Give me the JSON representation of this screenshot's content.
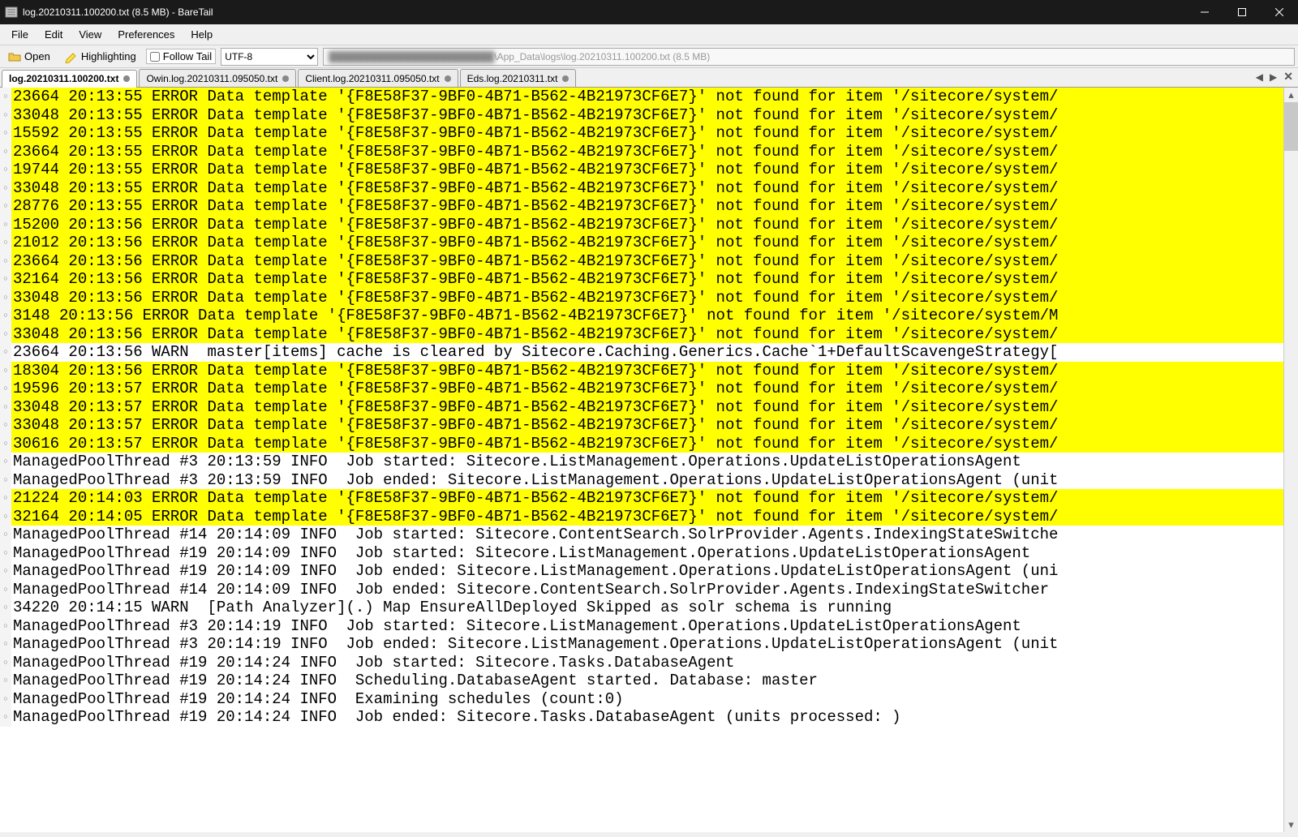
{
  "window": {
    "title": "log.20210311.100200.txt (8.5 MB) - BareTail"
  },
  "menu": {
    "file": "File",
    "edit": "Edit",
    "view": "View",
    "preferences": "Preferences",
    "help": "Help"
  },
  "toolbar": {
    "open": "Open",
    "highlighting": "Highlighting",
    "followtail": "Follow Tail",
    "encoding": "UTF-8",
    "path_suffix": "\\App_Data\\logs\\log.20210311.100200.txt (8.5 MB)"
  },
  "tabs": [
    {
      "label": "log.20210311.100200.txt",
      "active": true
    },
    {
      "label": "Owin.log.20210311.095050.txt",
      "active": false
    },
    {
      "label": "Client.log.20210311.095050.txt",
      "active": false
    },
    {
      "label": "Eds.log.20210311.txt",
      "active": false
    }
  ],
  "log": [
    {
      "hl": true,
      "text": "23664 20:13:55 ERROR Data template '{F8E58F37-9BF0-4B71-B562-4B21973CF6E7}' not found for item '/sitecore/system/"
    },
    {
      "hl": true,
      "text": "33048 20:13:55 ERROR Data template '{F8E58F37-9BF0-4B71-B562-4B21973CF6E7}' not found for item '/sitecore/system/"
    },
    {
      "hl": true,
      "text": "15592 20:13:55 ERROR Data template '{F8E58F37-9BF0-4B71-B562-4B21973CF6E7}' not found for item '/sitecore/system/"
    },
    {
      "hl": true,
      "text": "23664 20:13:55 ERROR Data template '{F8E58F37-9BF0-4B71-B562-4B21973CF6E7}' not found for item '/sitecore/system/"
    },
    {
      "hl": true,
      "text": "19744 20:13:55 ERROR Data template '{F8E58F37-9BF0-4B71-B562-4B21973CF6E7}' not found for item '/sitecore/system/"
    },
    {
      "hl": true,
      "text": "33048 20:13:55 ERROR Data template '{F8E58F37-9BF0-4B71-B562-4B21973CF6E7}' not found for item '/sitecore/system/"
    },
    {
      "hl": true,
      "text": "28776 20:13:55 ERROR Data template '{F8E58F37-9BF0-4B71-B562-4B21973CF6E7}' not found for item '/sitecore/system/"
    },
    {
      "hl": true,
      "text": "15200 20:13:56 ERROR Data template '{F8E58F37-9BF0-4B71-B562-4B21973CF6E7}' not found for item '/sitecore/system/"
    },
    {
      "hl": true,
      "text": "21012 20:13:56 ERROR Data template '{F8E58F37-9BF0-4B71-B562-4B21973CF6E7}' not found for item '/sitecore/system/"
    },
    {
      "hl": true,
      "text": "23664 20:13:56 ERROR Data template '{F8E58F37-9BF0-4B71-B562-4B21973CF6E7}' not found for item '/sitecore/system/"
    },
    {
      "hl": true,
      "text": "32164 20:13:56 ERROR Data template '{F8E58F37-9BF0-4B71-B562-4B21973CF6E7}' not found for item '/sitecore/system/"
    },
    {
      "hl": true,
      "text": "33048 20:13:56 ERROR Data template '{F8E58F37-9BF0-4B71-B562-4B21973CF6E7}' not found for item '/sitecore/system/"
    },
    {
      "hl": true,
      "text": "3148 20:13:56 ERROR Data template '{F8E58F37-9BF0-4B71-B562-4B21973CF6E7}' not found for item '/sitecore/system/M"
    },
    {
      "hl": true,
      "text": "33048 20:13:56 ERROR Data template '{F8E58F37-9BF0-4B71-B562-4B21973CF6E7}' not found for item '/sitecore/system/"
    },
    {
      "hl": false,
      "text": "23664 20:13:56 WARN  master[items] cache is cleared by Sitecore.Caching.Generics.Cache`1+DefaultScavengeStrategy["
    },
    {
      "hl": true,
      "text": "18304 20:13:56 ERROR Data template '{F8E58F37-9BF0-4B71-B562-4B21973CF6E7}' not found for item '/sitecore/system/"
    },
    {
      "hl": true,
      "text": "19596 20:13:57 ERROR Data template '{F8E58F37-9BF0-4B71-B562-4B21973CF6E7}' not found for item '/sitecore/system/"
    },
    {
      "hl": true,
      "text": "33048 20:13:57 ERROR Data template '{F8E58F37-9BF0-4B71-B562-4B21973CF6E7}' not found for item '/sitecore/system/"
    },
    {
      "hl": true,
      "text": "33048 20:13:57 ERROR Data template '{F8E58F37-9BF0-4B71-B562-4B21973CF6E7}' not found for item '/sitecore/system/"
    },
    {
      "hl": true,
      "text": "30616 20:13:57 ERROR Data template '{F8E58F37-9BF0-4B71-B562-4B21973CF6E7}' not found for item '/sitecore/system/"
    },
    {
      "hl": false,
      "text": "ManagedPoolThread #3 20:13:59 INFO  Job started: Sitecore.ListManagement.Operations.UpdateListOperationsAgent"
    },
    {
      "hl": false,
      "text": "ManagedPoolThread #3 20:13:59 INFO  Job ended: Sitecore.ListManagement.Operations.UpdateListOperationsAgent (unit"
    },
    {
      "hl": true,
      "text": "21224 20:14:03 ERROR Data template '{F8E58F37-9BF0-4B71-B562-4B21973CF6E7}' not found for item '/sitecore/system/"
    },
    {
      "hl": true,
      "text": "32164 20:14:05 ERROR Data template '{F8E58F37-9BF0-4B71-B562-4B21973CF6E7}' not found for item '/sitecore/system/"
    },
    {
      "hl": false,
      "text": "ManagedPoolThread #14 20:14:09 INFO  Job started: Sitecore.ContentSearch.SolrProvider.Agents.IndexingStateSwitche"
    },
    {
      "hl": false,
      "text": "ManagedPoolThread #19 20:14:09 INFO  Job started: Sitecore.ListManagement.Operations.UpdateListOperationsAgent"
    },
    {
      "hl": false,
      "text": "ManagedPoolThread #19 20:14:09 INFO  Job ended: Sitecore.ListManagement.Operations.UpdateListOperationsAgent (uni"
    },
    {
      "hl": false,
      "text": "ManagedPoolThread #14 20:14:09 INFO  Job ended: Sitecore.ContentSearch.SolrProvider.Agents.IndexingStateSwitcher"
    },
    {
      "hl": false,
      "text": "34220 20:14:15 WARN  [Path Analyzer](.) Map EnsureAllDeployed Skipped as solr schema is running"
    },
    {
      "hl": false,
      "text": "ManagedPoolThread #3 20:14:19 INFO  Job started: Sitecore.ListManagement.Operations.UpdateListOperationsAgent"
    },
    {
      "hl": false,
      "text": "ManagedPoolThread #3 20:14:19 INFO  Job ended: Sitecore.ListManagement.Operations.UpdateListOperationsAgent (unit"
    },
    {
      "hl": false,
      "text": "ManagedPoolThread #19 20:14:24 INFO  Job started: Sitecore.Tasks.DatabaseAgent"
    },
    {
      "hl": false,
      "text": "ManagedPoolThread #19 20:14:24 INFO  Scheduling.DatabaseAgent started. Database: master"
    },
    {
      "hl": false,
      "text": "ManagedPoolThread #19 20:14:24 INFO  Examining schedules (count:0)"
    },
    {
      "hl": false,
      "text": "ManagedPoolThread #19 20:14:24 INFO  Job ended: Sitecore.Tasks.DatabaseAgent (units processed: )"
    }
  ]
}
